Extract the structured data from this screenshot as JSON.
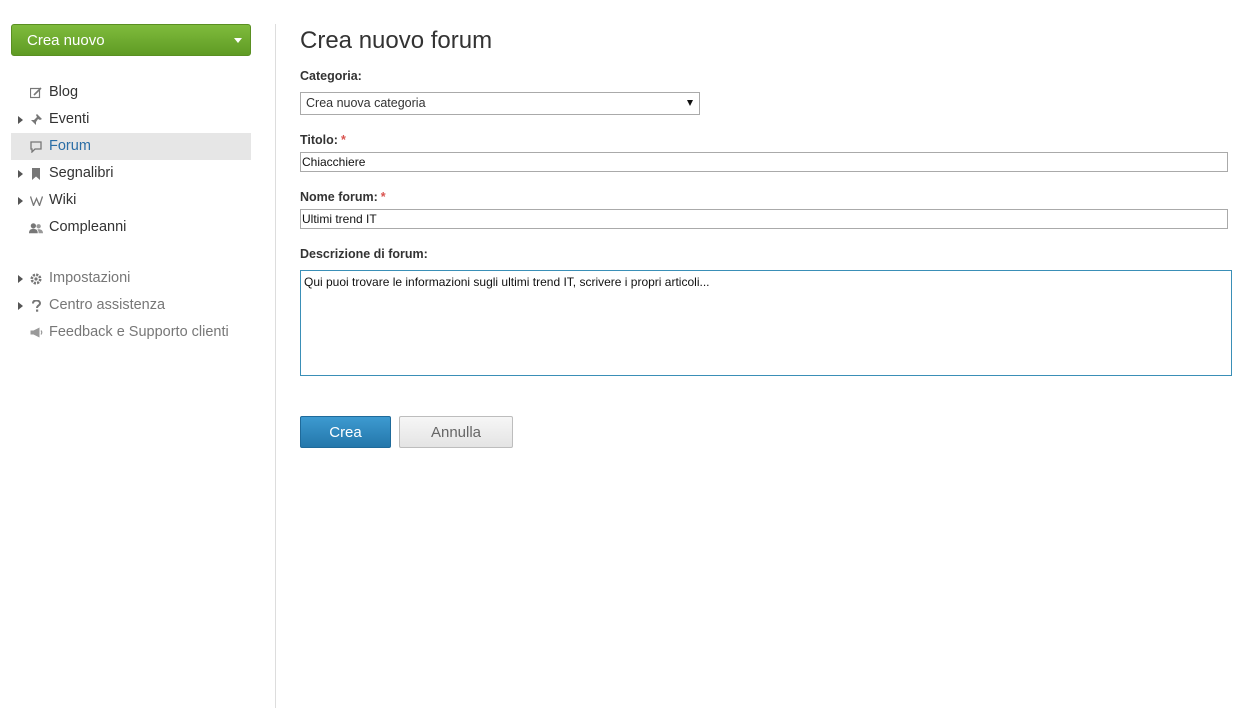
{
  "sidebar": {
    "create_button": "Crea nuovo",
    "primary_items": [
      {
        "label": "Blog",
        "icon": "edit-icon",
        "expandable": false,
        "active": false
      },
      {
        "label": "Eventi",
        "icon": "pin-icon",
        "expandable": true,
        "active": false
      },
      {
        "label": "Forum",
        "icon": "comment-icon",
        "expandable": false,
        "active": true
      },
      {
        "label": "Segnalibri",
        "icon": "bookmark-icon",
        "expandable": true,
        "active": false
      },
      {
        "label": "Wiki",
        "icon": "wiki-icon",
        "expandable": true,
        "active": false
      },
      {
        "label": "Compleanni",
        "icon": "users-icon",
        "expandable": false,
        "active": false
      }
    ],
    "secondary_items": [
      {
        "label": "Impostazioni",
        "icon": "gear-icon",
        "expandable": true
      },
      {
        "label": "Centro assistenza",
        "icon": "question-icon",
        "expandable": true
      },
      {
        "label": "Feedback e Supporto clienti",
        "icon": "megaphone-icon",
        "expandable": false
      }
    ]
  },
  "main": {
    "title": "Crea nuovo forum",
    "category": {
      "label": "Categoria:",
      "value": "Crea nuova categoria"
    },
    "title_field": {
      "label": "Titolo:",
      "required_mark": "*",
      "value": "Chiacchiere"
    },
    "forum_name": {
      "label": "Nome forum:",
      "required_mark": "*",
      "value": "Ultimi trend IT"
    },
    "description": {
      "label": "Descrizione di forum:",
      "value": "Qui puoi trovare le informazioni sugli ultimi trend IT, scrivere i propri articoli..."
    },
    "buttons": {
      "create": "Crea",
      "cancel": "Annulla"
    }
  },
  "colors": {
    "create_new_green": "#6ea92f",
    "primary_blue": "#2a83ba",
    "active_nav_bg": "#e6e6e6",
    "active_nav_text": "#2b6ea6",
    "required_red": "#d9534f"
  }
}
